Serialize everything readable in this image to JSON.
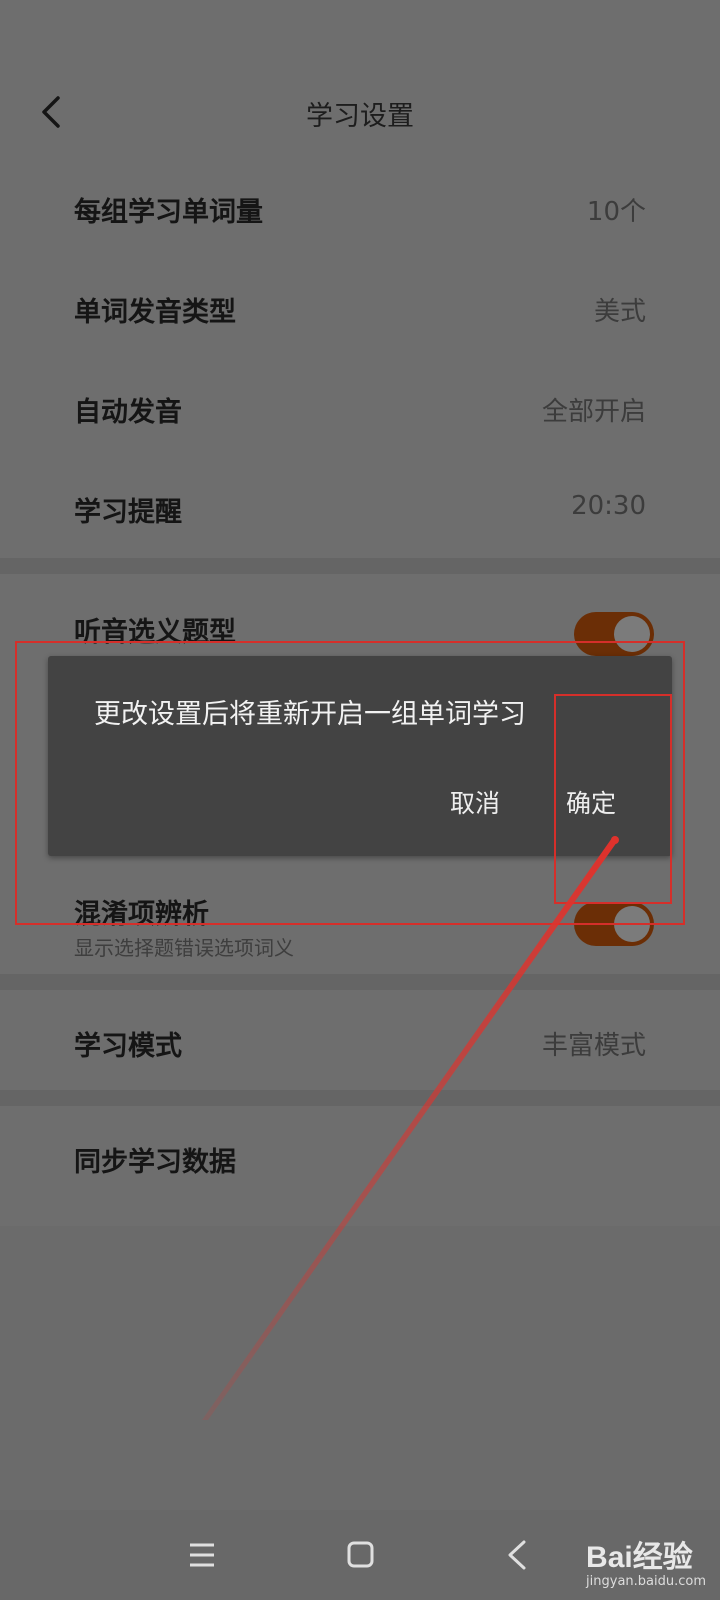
{
  "header": {
    "title": "学习设置"
  },
  "settings_group1": [
    {
      "label": "每组学习单词量",
      "value": "10个"
    },
    {
      "label": "单词发音类型",
      "value": "美式"
    },
    {
      "label": "自动发音",
      "value": "全部开启"
    },
    {
      "label": "学习提醒",
      "value": "20:30"
    }
  ],
  "toggle_rows": {
    "listen": {
      "label": "听音选义题型",
      "on": true
    },
    "confuse": {
      "label": "混淆项辨析",
      "sub": "显示选择题错误选项词义",
      "on": true
    }
  },
  "mode": {
    "label": "学习模式",
    "value": "丰富模式"
  },
  "sync": {
    "label": "同步学习数据"
  },
  "dialog": {
    "message": "更改设置后将重新开启一组单词学习",
    "cancel": "取消",
    "confirm": "确定"
  },
  "watermark": {
    "brand": "Bai经验",
    "url": "jingyan.baidu.com"
  },
  "colors": {
    "toggle_track": "#6b2e06",
    "annotation": "#d52f2a"
  }
}
